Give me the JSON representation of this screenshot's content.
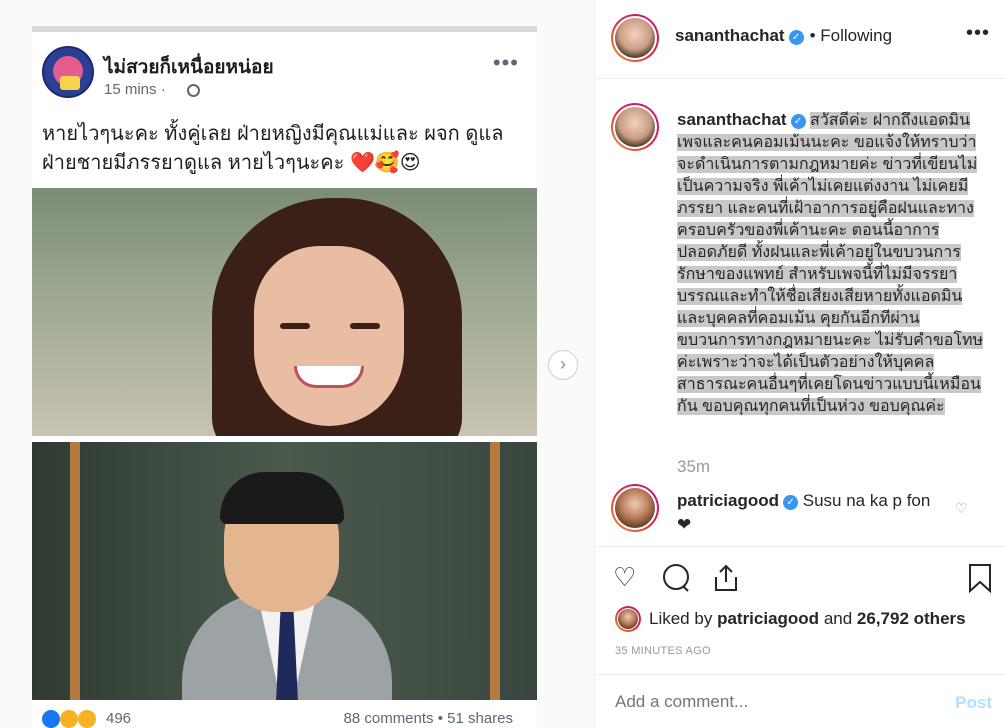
{
  "facebook_post": {
    "page_name": "ไม่สวยก็เหนื่อยหน่อย",
    "time": "15 mins ·",
    "text": "หายไวๆนะคะ ทั้งคู่เลย ฝ่ายหญิงมีคุณแม่และ ผจก ดูแล ฝ่ายชายมีภรรยาดูแล หายไวๆนะคะ ❤️🥰😍",
    "reaction_count": "496",
    "stats": "88 comments • 51 shares"
  },
  "header": {
    "username": "sananthachat",
    "following": "• Following"
  },
  "caption": {
    "username": "sananthachat",
    "text": "สวัสดีค่ะ ฝากถึงแอดมินเพจและคนคอมเม้นนะคะ ขอแจ้งให้ทราบว่าจะดำเนินการตามกฎหมายค่ะ ข่าวที่เขียนไม่เป็นความจริง พี่เค้าไม่เคยแต่งงาน ไม่เคยมีภรรยา และคนที่เฝ้าอาการอยู่คือฝนและทางครอบครัวของพี่เค้านะคะ ตอนนี้อาการปลอดภัยดี ทั้งฝนและพี่เค้าอยู่ในขบวนการรักษาของแพทย์ สำหรับเพจนี้ที่ไม่มีจรรยาบรรณและทำให้ชื่อเสียงเสียหายทั้งแอดมินและบุคคลที่คอมเม้น คุยกันอีกทีผ่านขบวนการทางกฎหมายนะคะ ไม่รับคำขอโทษค่ะเพราะว่าจะได้เป็นตัวอย่างให้บุคคลสาธารณะคนอื่นๆที่เคยโดนข่าวแบบนี้เหมือนกัน ขอบคุณทุกคนที่เป็นห่วง ขอบคุณค่ะ",
    "time": "35m"
  },
  "comment": {
    "username": "patriciagood",
    "text": "Susu na ka p fon",
    "emoji": "❤"
  },
  "likes": {
    "prefix": "Liked by",
    "user": "patriciagood",
    "middle": "and",
    "count": "26,792 others"
  },
  "time_ago": "35 MINUTES AGO",
  "add_comment": {
    "placeholder": "Add a comment...",
    "post_label": "Post"
  },
  "colors": {
    "verified": "#3897f0",
    "post_disabled": "#b2dffc",
    "highlight": "#c8c8c8"
  }
}
